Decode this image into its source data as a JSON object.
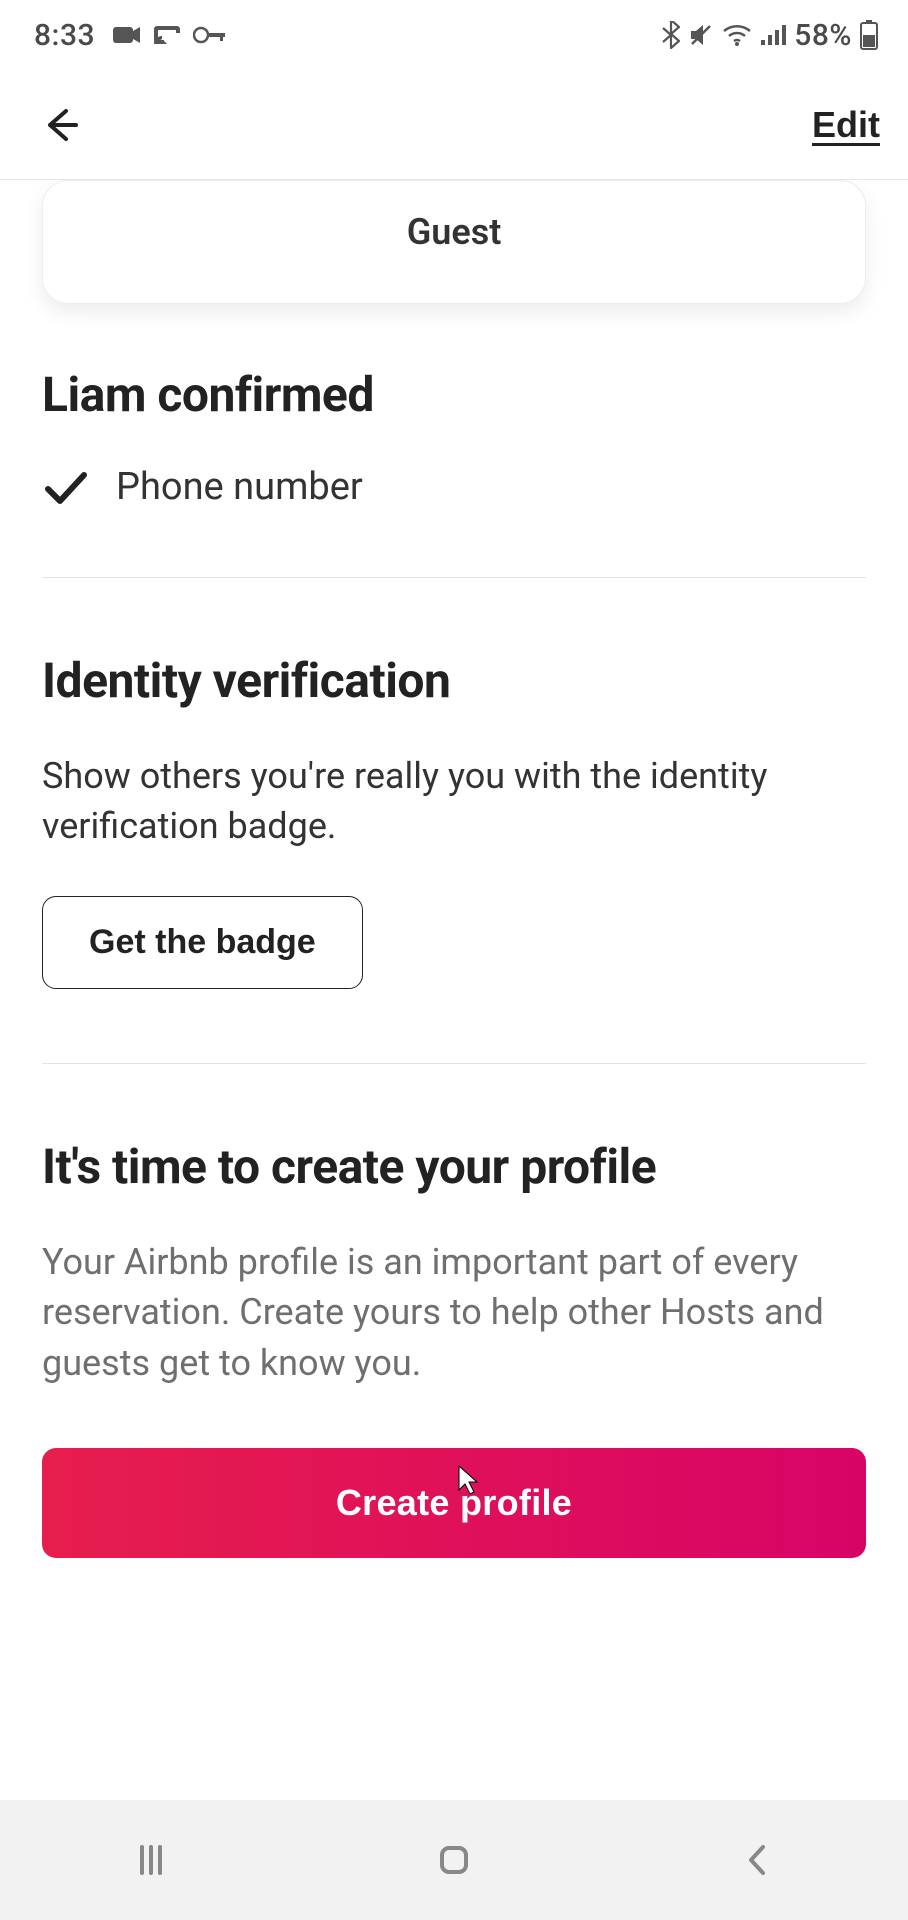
{
  "status": {
    "time": "8:33",
    "battery_percent": "58%"
  },
  "header": {
    "edit_label": "Edit"
  },
  "guest_card": {
    "label": "Guest"
  },
  "confirmed": {
    "heading": "Liam confirmed",
    "items": [
      "Phone number"
    ]
  },
  "identity": {
    "heading": "Identity verification",
    "body": "Show others you're really you with the identity verification badge.",
    "button": "Get the badge"
  },
  "profile_prompt": {
    "heading": "It's time to create your profile",
    "body": "Your Airbnb profile is an important part of every reservation. Create yours to help other Hosts and guests get to know you.",
    "button": "Create profile"
  }
}
